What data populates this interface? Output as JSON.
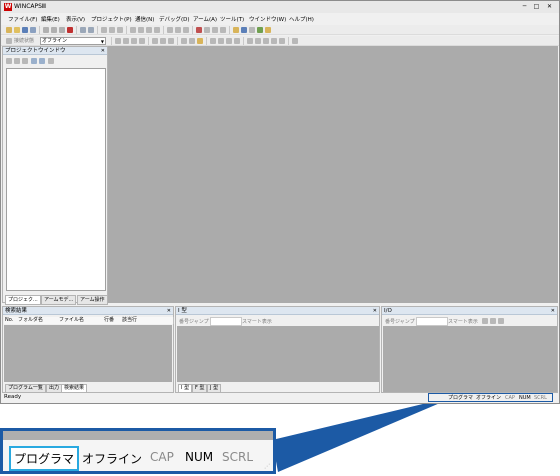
{
  "app": {
    "title": "WINCAPSⅢ",
    "logo_letter": "W"
  },
  "window_buttons": [
    "─",
    "□",
    "✕"
  ],
  "menu": [
    "ファイル(F)",
    "編集(E)",
    "表示(V)",
    "プロジェクト(P)",
    "通信(N)",
    "デバッグ(D)",
    "アーム(A)",
    "ツール(T)",
    "ウインドウ(W)",
    "ヘルプ(H)"
  ],
  "toolbar2": {
    "combo_label": "接続状態",
    "combo_value": "オフライン"
  },
  "project_panel": {
    "title": "プロジェクトウインドウ",
    "tabs": [
      "プロジェク...",
      "アームモデ...",
      "アーム操作"
    ]
  },
  "search_panel": {
    "title": "検索結果",
    "columns": [
      "No.",
      "フォルダ名",
      "ファイル名",
      "行番",
      "該当行"
    ],
    "tabs": [
      "プログラム一覧",
      "出力",
      "検索結果"
    ]
  },
  "type_panel": {
    "title": "I 型",
    "jump_label": "番号ジャンプ",
    "smart_label": "スマート表示",
    "tabs": [
      "I 型",
      "F 型",
      "J 型"
    ]
  },
  "io_panel": {
    "title": "I/O",
    "jump_label": "番号ジャンプ",
    "smart_label": "スマート表示"
  },
  "status": {
    "ready": "Ready",
    "mode": "プログラマ",
    "conn": "オフライン",
    "cap": "CAP",
    "num": "NUM",
    "scrl": "SCRL"
  },
  "callout": {
    "mode": "プログラマ",
    "conn": "オフライン",
    "cap": "CAP",
    "num": "NUM",
    "scrl": "SCRL"
  },
  "colors": {
    "accent": "#1c5aa5",
    "highlight": "#29a9e0",
    "mdi_background": "#ababab"
  }
}
